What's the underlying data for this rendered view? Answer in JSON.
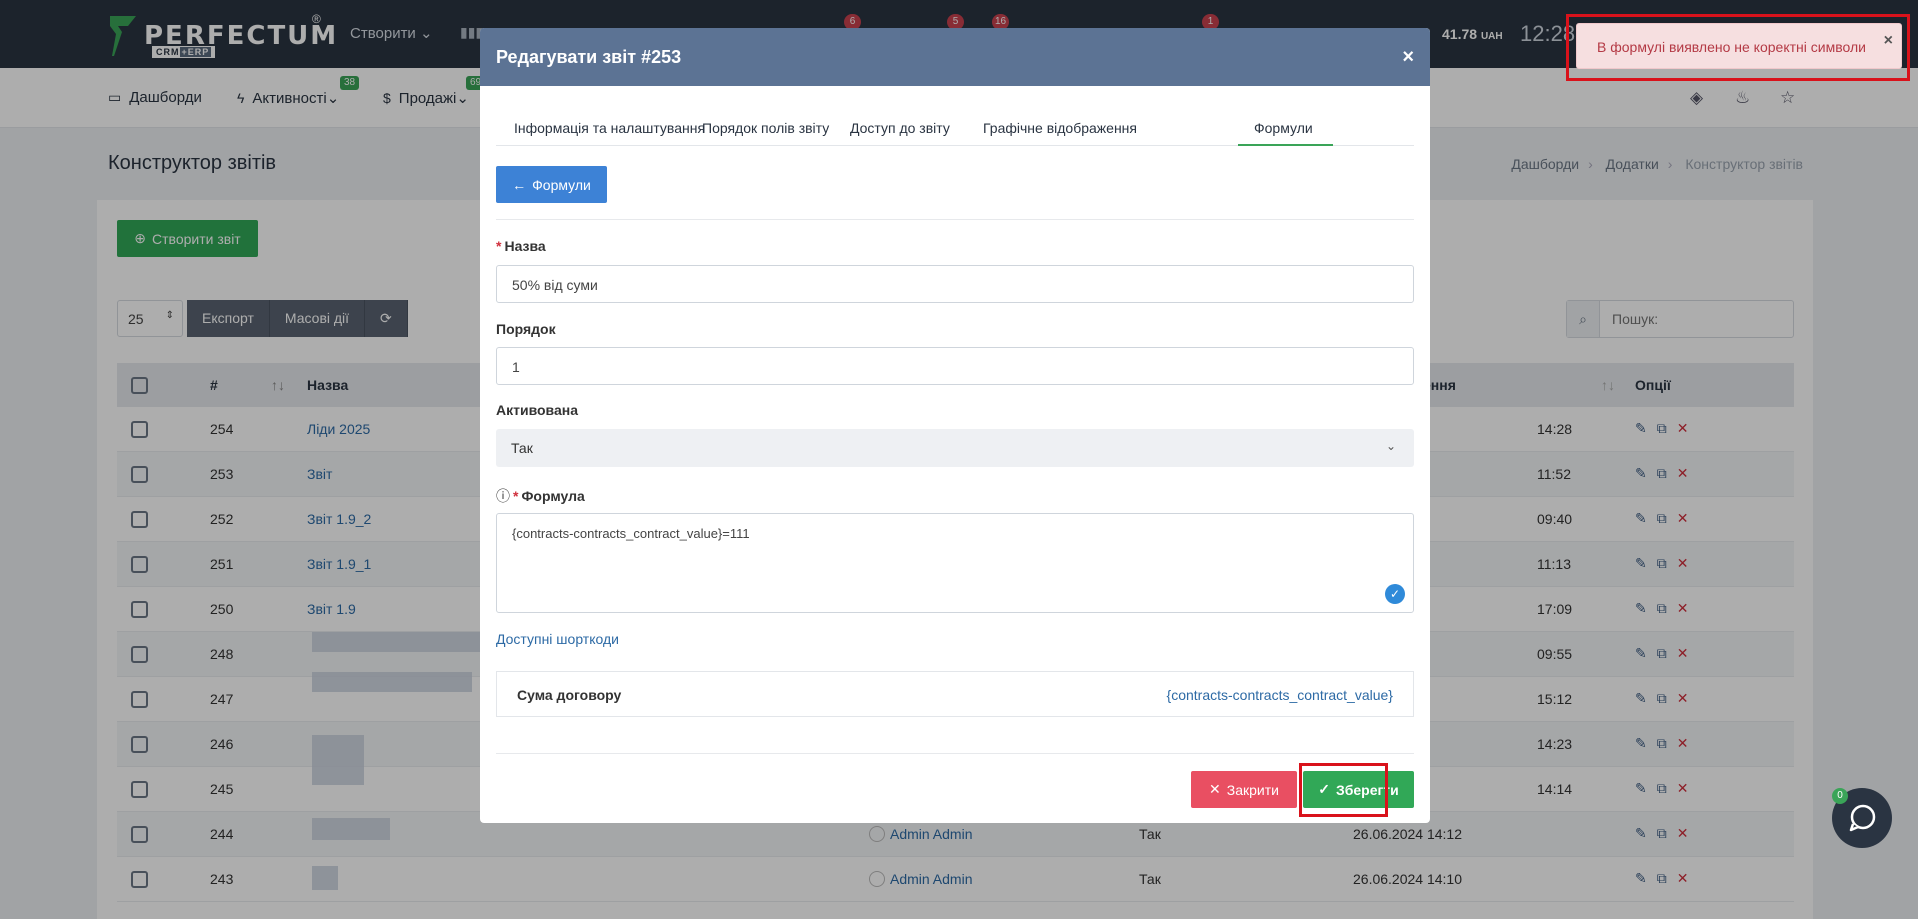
{
  "topbar": {
    "logo_text": "PERFECTUM",
    "logo_reg": "®",
    "logo_sub_a": "CRM",
    "logo_sub_b": "+ERP",
    "create_label": "Створити",
    "badges": [
      "6",
      "5",
      "16",
      "1"
    ],
    "balance": "41.78",
    "currency": "UAH",
    "clock": "12:28"
  },
  "nav": {
    "dashboards": "Дашборди",
    "activities": "Активності",
    "activities_badge": "38",
    "sales": "Продажі",
    "sales_badge": "69"
  },
  "page": {
    "title": "Конструктор звітів",
    "breadcrumbs": [
      "Дашборди",
      "Додатки",
      "Конструктор звітів"
    ],
    "create_button": "Створити звіт",
    "page_size": "25",
    "export_button": "Експорт",
    "bulk_button": "Масові дії",
    "search_placeholder": "Пошук:"
  },
  "table": {
    "headers": {
      "num": "#",
      "name": "Назва",
      "date": "ення",
      "options": "Опції"
    },
    "rows": [
      {
        "id": "254",
        "name": "Ліди 2025",
        "date": "14:28",
        "author": "",
        "active": ""
      },
      {
        "id": "253",
        "name": "Звіт",
        "date": "11:52",
        "author": "",
        "active": ""
      },
      {
        "id": "252",
        "name": "Звіт 1.9_2",
        "date": "09:40",
        "author": "",
        "active": ""
      },
      {
        "id": "251",
        "name": "Звіт 1.9_1",
        "date": "11:13",
        "author": "",
        "active": ""
      },
      {
        "id": "250",
        "name": "Звіт 1.9",
        "date": "17:09",
        "author": "",
        "active": ""
      },
      {
        "id": "248",
        "name": "",
        "date": "09:55",
        "author": "",
        "active": ""
      },
      {
        "id": "247",
        "name": "",
        "date": "15:12",
        "author": "",
        "active": ""
      },
      {
        "id": "246",
        "name": "",
        "date": "14:23",
        "author": "",
        "active": ""
      },
      {
        "id": "245",
        "name": "",
        "date": "14:14",
        "author": "",
        "active": ""
      },
      {
        "id": "244",
        "name": "",
        "date": "26.06.2024 14:12",
        "author": "Admin Admin",
        "active": "Так"
      },
      {
        "id": "243",
        "name": "",
        "date": "26.06.2024 14:10",
        "author": "Admin Admin",
        "active": "Так"
      }
    ]
  },
  "modal": {
    "title": "Редагувати звіт #253",
    "tabs": [
      "Інформація та налаштування",
      "Порядок полів звіту",
      "Доступ до звіту",
      "Графічне відображення",
      "Формули"
    ],
    "back_button": "Формули",
    "name_label": "Назва",
    "name_value": "50% від суми",
    "order_label": "Порядок",
    "order_value": "1",
    "active_label": "Активована",
    "active_value": "Так",
    "formula_label": "Формула",
    "formula_value": "{contracts-contracts_contract_value}=111",
    "shortcodes_link": "Доступні шорткоди",
    "shortcode_name": "Сума договору",
    "shortcode_code": "{contracts-contracts_contract_value}",
    "close_button": "Закрити",
    "save_button": "Зберегти"
  },
  "toast": {
    "message": "В формулі виявлено не коректні символи"
  },
  "chat": {
    "badge": "0"
  },
  "colors": {
    "primary_green": "#31a857",
    "modal_header": "#5c7394",
    "danger": "#e94f62",
    "highlight": "#d9121b"
  }
}
